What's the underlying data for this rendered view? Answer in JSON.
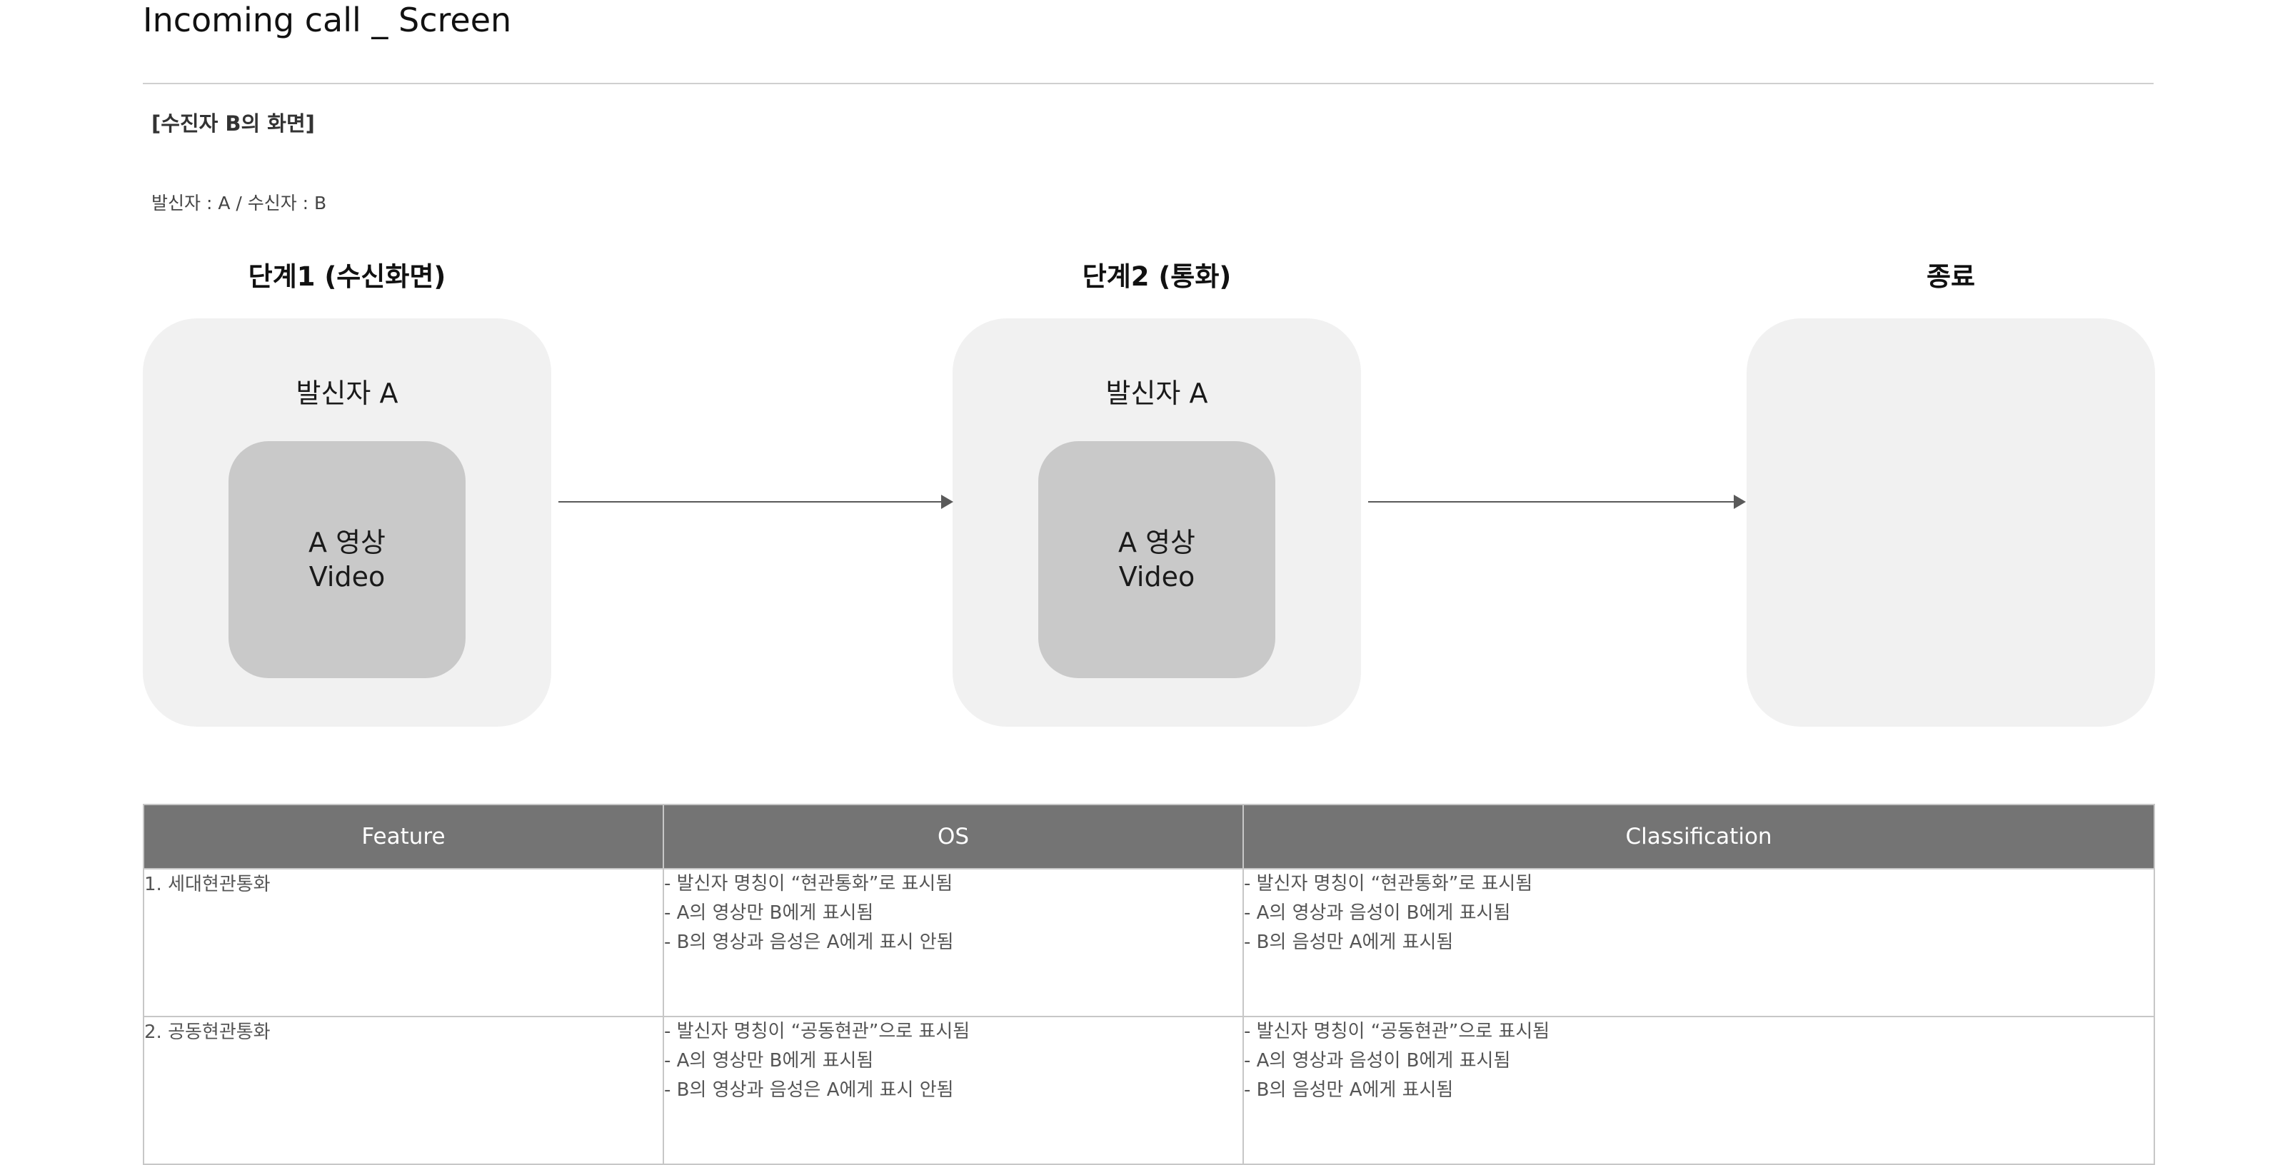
{
  "page": {
    "title": "Incoming call _ Screen",
    "section_label": "[수진자 B의 화면]",
    "roles_note": "발신자 : A / 수신자 : B"
  },
  "stages": [
    {
      "title": "단계1 (수신화면)",
      "caller_label": "발신자 A",
      "video_line1": "A 영상",
      "video_line2": "Video"
    },
    {
      "title": "단계2 (통화)",
      "caller_label": "발신자 A",
      "video_line1": "A 영상",
      "video_line2": "Video"
    },
    {
      "title": "종료"
    }
  ],
  "table": {
    "headers": [
      "Feature",
      "OS",
      "Classification"
    ],
    "rows": [
      {
        "feature": "1. 세대현관통화",
        "os": [
          "- 발신자 명칭이 “현관통화”로 표시됨",
          "- A의 영상만 B에게 표시됨",
          "- B의 영상과 음성은 A에게 표시 안됨"
        ],
        "classification": [
          "- 발신자 명칭이 “현관통화”로 표시됨",
          "- A의 영상과 음성이 B에게 표시됨",
          "- B의 음성만 A에게 표시됨"
        ]
      },
      {
        "feature": "2. 공동현관통화",
        "os": [
          "- 발신자 명칭이 “공동현관”으로 표시됨",
          "- A의 영상만 B에게 표시됨",
          "- B의 영상과 음성은 A에게 표시 안됨"
        ],
        "classification": [
          "- 발신자 명칭이 “공동현관”으로 표시됨",
          "- A의 영상과 음성이 B에게 표시됨",
          "- B의 음성만 A에게 표시됨"
        ]
      }
    ]
  }
}
